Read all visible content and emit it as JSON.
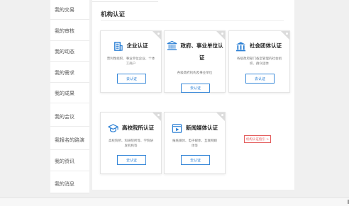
{
  "sidebar": {
    "items": [
      {
        "label": "我的交易"
      },
      {
        "label": "我的审核"
      },
      {
        "label": "我的动态"
      },
      {
        "label": "我的需求"
      },
      {
        "label": "我的成果"
      },
      {
        "label": "我的会议"
      },
      {
        "label": "我报名的路演"
      },
      {
        "label": "我的资讯"
      },
      {
        "label": "我的消息"
      }
    ]
  },
  "main": {
    "section_title": "机构认证",
    "cards": [
      {
        "title": "企业认证",
        "desc": "营利性组织、事业单位企业、个体工商户",
        "button": "去认证",
        "icon": "enterprise-building-icon"
      },
      {
        "title": "政府、事业单位认证",
        "desc": "各级政府机构及事业单位",
        "button": "去认证",
        "icon": "government-building-icon"
      },
      {
        "title": "社会团体认证",
        "desc": "各级政府部门备案管理的社会组织、群众团体",
        "button": "去认证",
        "icon": "social-organization-icon"
      },
      {
        "title": "高校院所认证",
        "desc": "高校院所、科研院所等、学院研发机构等",
        "button": "去认证",
        "icon": "graduation-cap-icon"
      },
      {
        "title": "新闻媒体认证",
        "desc": "报纸媒体、电子媒体、互联网媒体等",
        "button": "去认证",
        "icon": "media-video-icon"
      }
    ],
    "help_link": "机构认证指引 >"
  },
  "colors": {
    "accent": "#2a7fd4",
    "link_red": "#e35d5d",
    "background": "#f0f0f0"
  }
}
